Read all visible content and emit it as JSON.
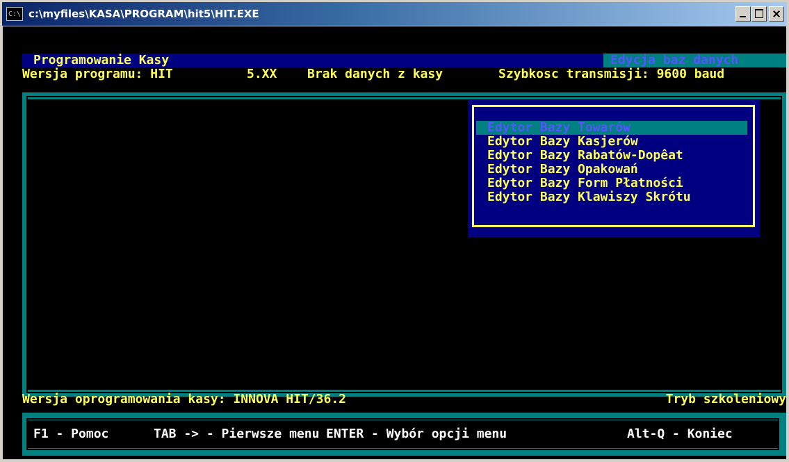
{
  "window": {
    "title": "c:\\myfiles\\KASA\\PROGRAM\\hit5\\HIT.EXE",
    "icon_text": "C:\\"
  },
  "header": {
    "program_title": "Programowanie Kasy",
    "mode": "Edycja baz danych",
    "version_label": "Wersja programu: HIT",
    "version_value": "5.XX",
    "data_status": "Brak danych z kasy",
    "baud_rate": "Szybkosc transmisji: 9600 baud"
  },
  "menu": {
    "items": [
      {
        "label": "Edytor Bazy Towarów",
        "selected": true
      },
      {
        "label": "Edytor Bazy Kasjerów",
        "selected": false
      },
      {
        "label": "Edytor Bazy Rabatów-Dopêat",
        "selected": false
      },
      {
        "label": "Edytor Bazy Opakowań",
        "selected": false
      },
      {
        "label": "Edytor Bazy Form Płatności",
        "selected": false
      },
      {
        "label": "Edytor Bazy Klawiszy Skrótu",
        "selected": false
      }
    ]
  },
  "status": {
    "firmware": "Wersja oprogramowania kasy: INNOVA HIT/36.2",
    "training_mode": "Tryb szkoleniowy"
  },
  "footer": {
    "help": "F1 - Pomoc",
    "first_menu": "TAB -> - Pierwsze menu",
    "select": "ENTER - Wybór opcji menu",
    "quit": "Alt-Q - Koniec"
  },
  "colors": {
    "console_bg": "#000000",
    "dos_blue": "#000080",
    "dos_cyan": "#008080",
    "dos_yellow": "#ffff55",
    "dos_light_blue": "#5555ff",
    "dos_white": "#ffffff"
  },
  "icons": {
    "window_icon": "console-icon",
    "minimize": "minimize-icon",
    "maximize": "maximize-icon",
    "close": "close-icon"
  }
}
